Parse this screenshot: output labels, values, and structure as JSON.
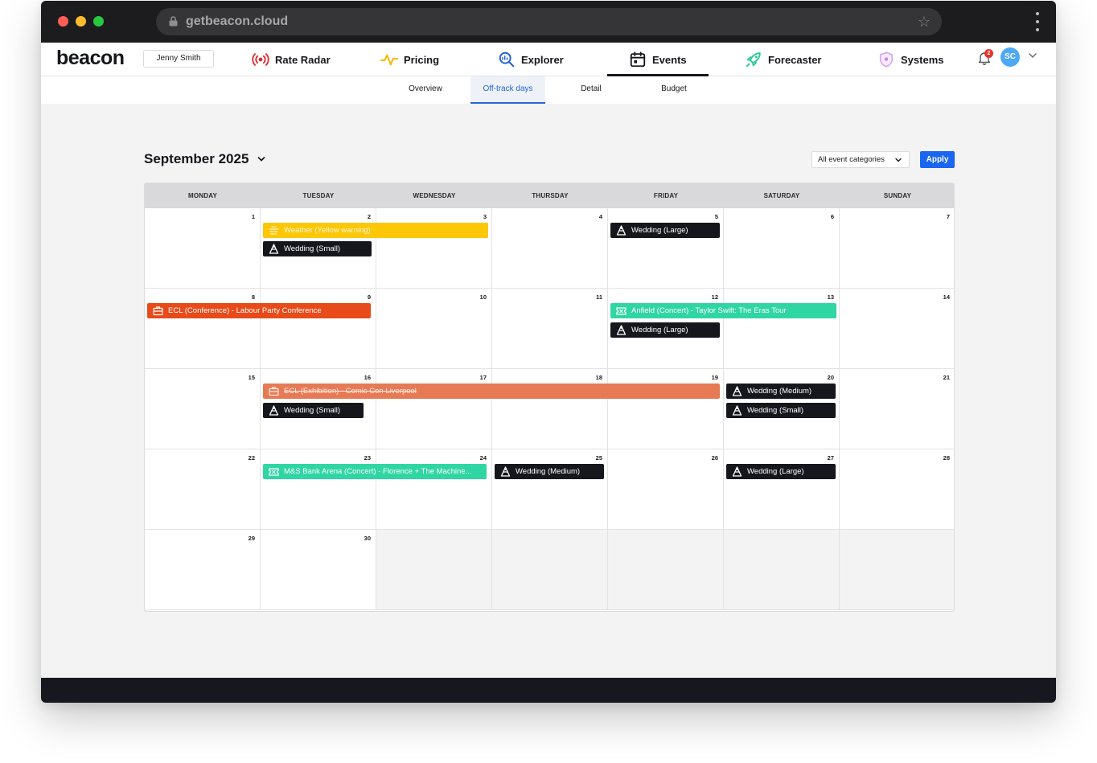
{
  "browser": {
    "url": "getbeacon.cloud"
  },
  "header": {
    "logo": "beacon",
    "user_name": "Jenny Smith",
    "nav": [
      {
        "label": "Rate Radar",
        "icon": "radar-icon"
      },
      {
        "label": "Pricing",
        "icon": "pricing-pulse-icon"
      },
      {
        "label": "Explorer",
        "icon": "explorer-search-icon"
      },
      {
        "label": "Events",
        "icon": "calendar-icon",
        "active": true
      },
      {
        "label": "Forecaster",
        "icon": "rocket-icon"
      },
      {
        "label": "Systems",
        "icon": "shield-icon"
      }
    ],
    "notifications": "2",
    "avatar_initials": "SC"
  },
  "subnav": {
    "tabs": [
      {
        "label": "Overview"
      },
      {
        "label": "Off-track days",
        "active": true
      },
      {
        "label": "Detail"
      },
      {
        "label": "Budget"
      }
    ]
  },
  "toolbar": {
    "month_label": "September 2025",
    "category_filter": "All event categories",
    "apply_label": "Apply"
  },
  "calendar": {
    "weekdays": [
      "MONDAY",
      "TUESDAY",
      "WEDNESDAY",
      "THURSDAY",
      "FRIDAY",
      "SATURDAY",
      "SUNDAY"
    ],
    "weeks": [
      [
        "1",
        "2",
        "3",
        "4",
        "5",
        "6",
        "7"
      ],
      [
        "8",
        "9",
        "10",
        "11",
        "12",
        "13",
        "14"
      ],
      [
        "15",
        "16",
        "17",
        "18",
        "19",
        "20",
        "21"
      ],
      [
        "22",
        "23",
        "24",
        "25",
        "26",
        "27",
        "28"
      ],
      [
        "29",
        "30",
        "",
        "",
        "",
        "",
        ""
      ]
    ],
    "events": [
      {
        "label": "Weather (Yellow warning)",
        "style": "yellow",
        "icon": "weather-icon"
      },
      {
        "label": "Wedding (Small)",
        "style": "dark",
        "icon": "wedding-icon"
      },
      {
        "label": "Wedding (Large)",
        "style": "dark",
        "icon": "wedding-icon"
      },
      {
        "label": "ECL (Conference) - Labour Party Conference",
        "style": "red",
        "icon": "briefcase-icon"
      },
      {
        "label": "Anfield (Concert) - Taylor Swift: The Eras Tour",
        "style": "teal",
        "icon": "ticket-icon"
      },
      {
        "label": "Wedding (Large)",
        "style": "dark",
        "icon": "wedding-icon"
      },
      {
        "label": "ECL (Exhibition) - Comic Con Liverpool",
        "style": "salmon",
        "icon": "briefcase-icon",
        "struck": true
      },
      {
        "label": "Wedding (Small)",
        "style": "dark",
        "icon": "wedding-icon"
      },
      {
        "label": "Wedding (Medium)",
        "style": "dark",
        "icon": "wedding-icon"
      },
      {
        "label": "Wedding (Small)",
        "style": "dark",
        "icon": "wedding-icon"
      },
      {
        "label": "M&S Bank Arena (Concert) - Florence + The Machine...",
        "style": "teal",
        "icon": "ticket-icon"
      },
      {
        "label": "Wedding (Medium)",
        "style": "dark",
        "icon": "wedding-icon"
      },
      {
        "label": "Wedding (Large)",
        "style": "dark",
        "icon": "wedding-icon"
      }
    ]
  },
  "colors": {
    "accent": "#1a66f0",
    "active_tab": "#2563d9",
    "weather": "#fbc707",
    "conference": "#e84a19",
    "concert": "#2fd6a4",
    "exhibition": "#e57a55",
    "wedding": "#16171d"
  }
}
